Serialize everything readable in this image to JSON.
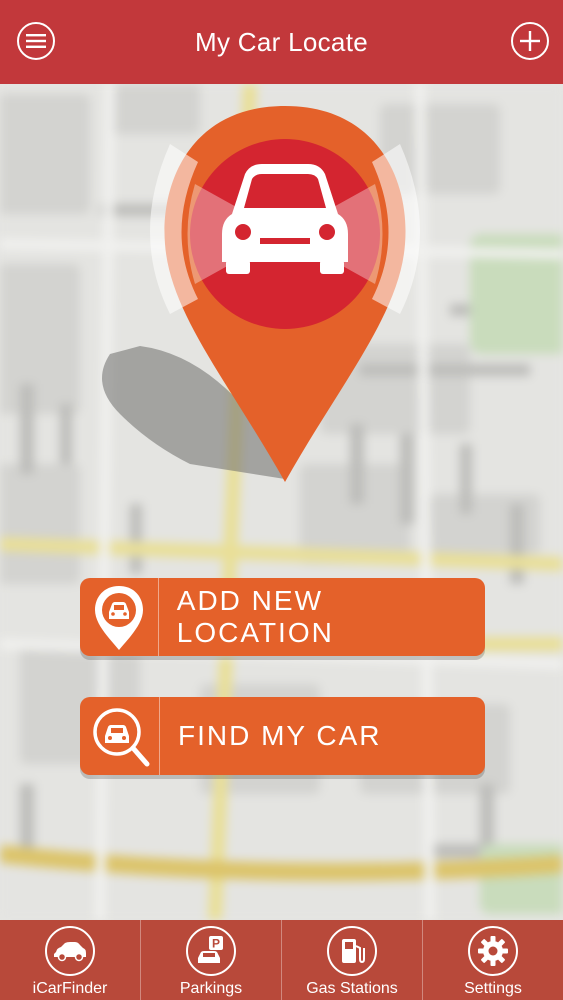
{
  "header": {
    "title": "My Car Locate",
    "menu_icon": "hamburger-menu-icon",
    "add_icon": "plus-icon"
  },
  "actions": [
    {
      "label": "ADD NEW LOCATION",
      "icon": "car-pin-icon"
    },
    {
      "label": "FIND MY CAR",
      "icon": "car-search-icon"
    }
  ],
  "tabs": [
    {
      "label": "iCarFinder",
      "icon": "car-icon"
    },
    {
      "label": "Parkings",
      "icon": "parking-icon"
    },
    {
      "label": "Gas Stations",
      "icon": "gas-pump-icon"
    },
    {
      "label": "Settings",
      "icon": "gear-icon"
    }
  ],
  "colors": {
    "header": "#c2383b",
    "accent": "#e4612a",
    "tabbar": "#b8493a",
    "pin": "#e4612a",
    "pin_inner": "#d42530"
  }
}
